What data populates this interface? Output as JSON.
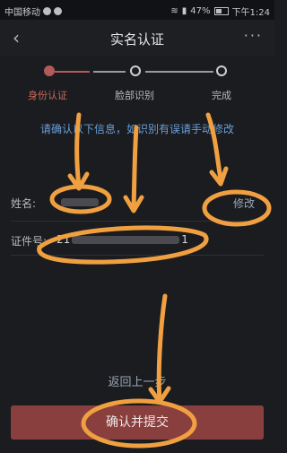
{
  "status_bar": {
    "carrier": "中国移动",
    "battery": "47%",
    "time": "下午1:24"
  },
  "nav": {
    "back_icon": "chevron-left-icon",
    "title": "实名认证",
    "more_icon": "more-dots-icon"
  },
  "steps": [
    {
      "label": "身份认证",
      "state": "active"
    },
    {
      "label": "脸部识别",
      "state": "pending"
    },
    {
      "label": "完成",
      "state": "pending"
    }
  ],
  "notice": "请确认以下信息，如识别有误请手动修改",
  "fields": {
    "name_label": "姓名:",
    "edit_label": "修改",
    "id_label": "证件号:",
    "id_value_prefix": "21",
    "id_value_suffix": "1"
  },
  "actions": {
    "back_step": "返回上一步",
    "submit": "确认并提交"
  },
  "colors": {
    "accent": "#b45a5a",
    "annotation": "#f0a040",
    "link": "#6a9fd6"
  }
}
